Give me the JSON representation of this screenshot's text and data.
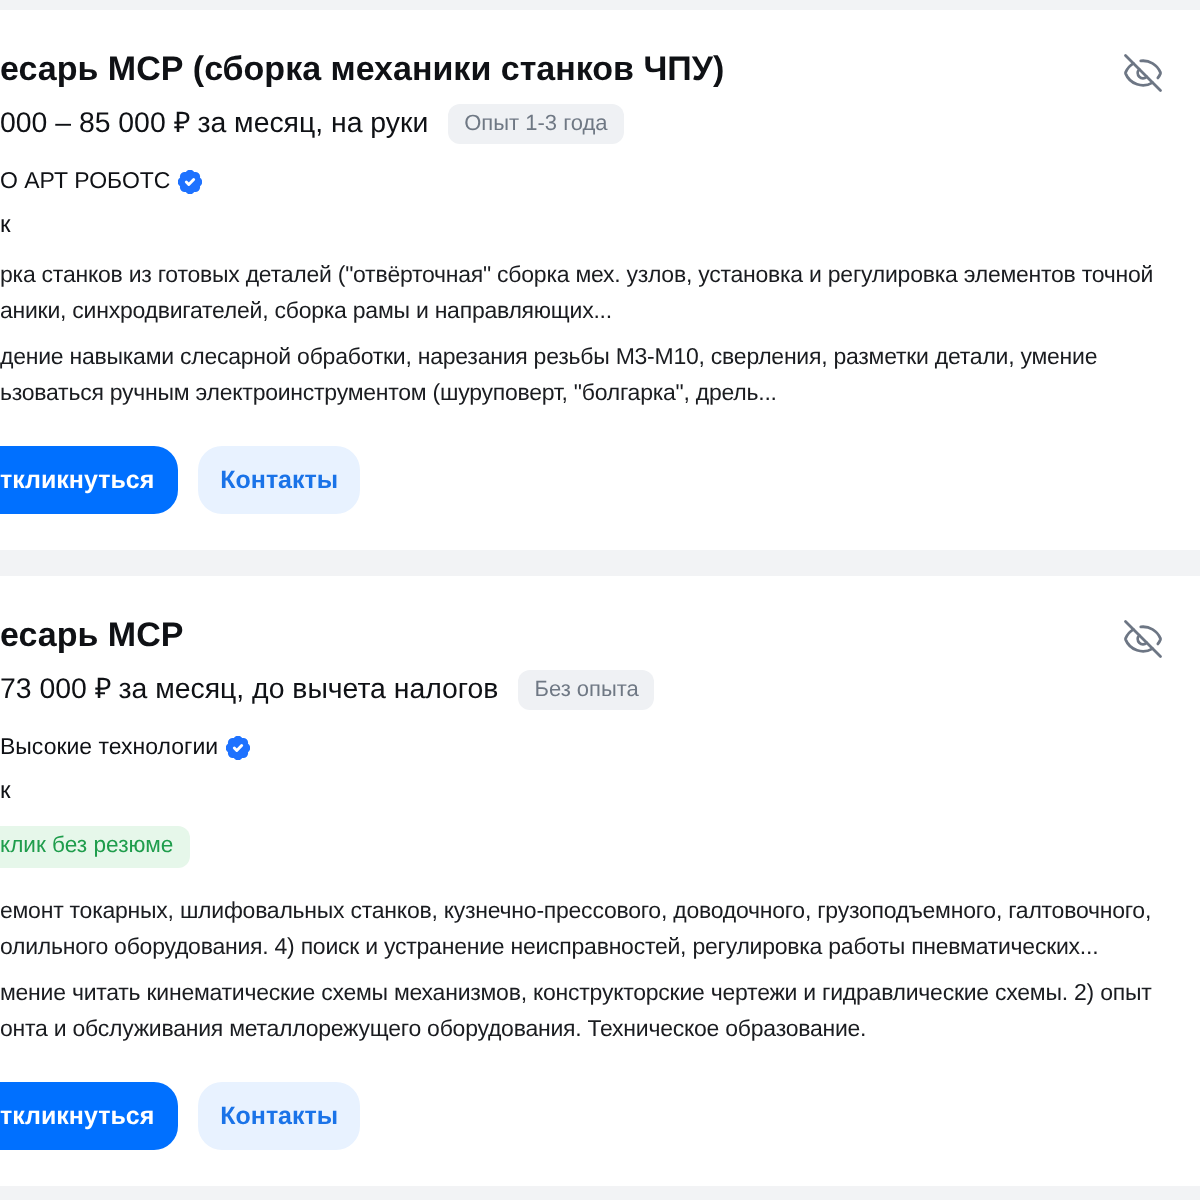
{
  "vacancies": [
    {
      "title": "есарь МСР (сборка механики станков ЧПУ)",
      "salary": "000 – 85 000 ₽ за месяц, на руки",
      "experience": "Опыт 1-3 года",
      "company": "О АРТ РОБОТС",
      "verified": true,
      "city": "к",
      "snippets": [
        [
          "рка станков из готовых деталей (\"отвёрточная\" сборка мех. узлов, установка и регулировка элементов точной",
          "аники, синхродвигателей, сборка рамы и направляющих..."
        ],
        [
          "дение навыками слесарной обработки, нарезания резьбы М3-М10, сверления, разметки детали, умение",
          "ьзоваться ручным электроинструментом (шуруповерт, \"болгарка\", дрель..."
        ]
      ],
      "buttons": [
        {
          "label": "ткликнуться",
          "kind": "primary"
        },
        {
          "label": "Контакты",
          "kind": "secondary"
        }
      ]
    },
    {
      "title": "есарь МСР",
      "salary": "73 000 ₽ за месяц, до вычета налогов",
      "experience": "Без опыта",
      "company": "Высокие технологии",
      "verified": true,
      "city": "к",
      "tags": [
        "клик без резюме"
      ],
      "snippets": [
        [
          "емонт токарных, шлифовальных станков, кузнечно-прессового, доводочного, грузоподъемного, галтовочного,",
          "олильного оборудования. 4) поиск и устранение неисправностей, регулировка работы пневматических..."
        ],
        [
          "мение читать кинематические схемы механизмов, конструкторские чертежи и гидравлические схемы. 2) опыт",
          "онта и обслуживания металлорежущего оборудования. Техническое образование."
        ]
      ],
      "buttons": [
        {
          "label": "ткликнуться",
          "kind": "primary"
        },
        {
          "label": "Контакты",
          "kind": "secondary"
        }
      ]
    }
  ]
}
